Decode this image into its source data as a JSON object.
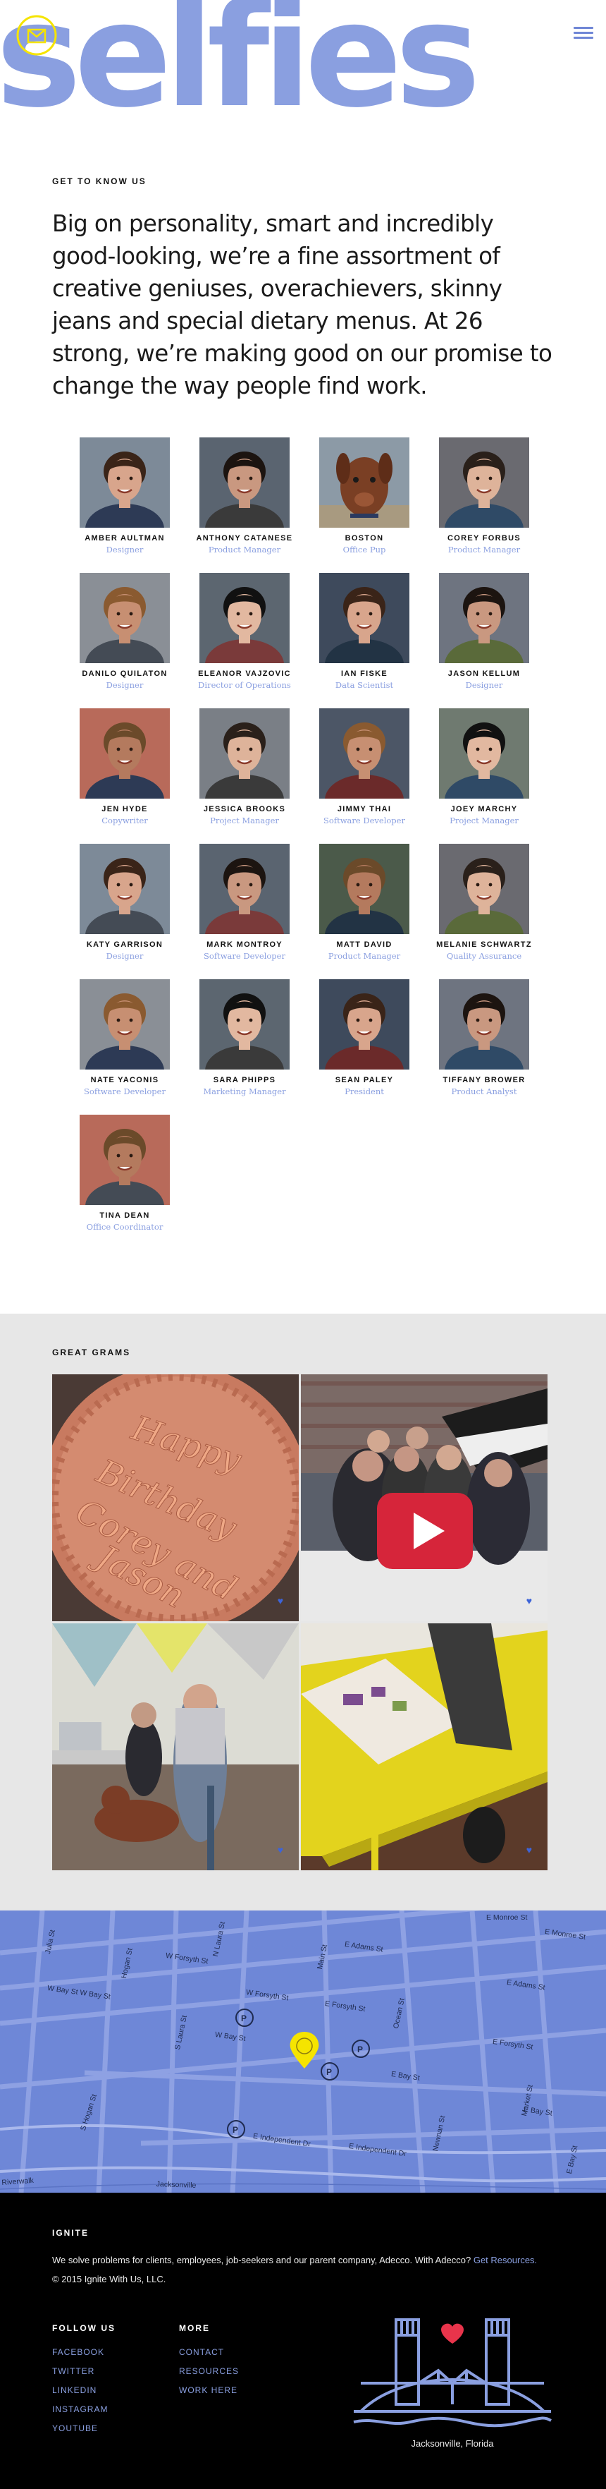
{
  "hero": {
    "word": "selfies",
    "logo_icon": "mail-location-badge-icon",
    "menu_icon": "hamburger-menu-icon",
    "accent_color": "#8a9fe0",
    "badge_color": "#f5e400"
  },
  "about": {
    "eyebrow": "GET TO KNOW US",
    "lead": "Big on personality, smart and incredibly good-looking, we’re a fine assortment of creative geniuses, overachievers, skinny jeans and special dietary menus. At 26 strong, we’re making good on our promise to change the way people find work."
  },
  "team": [
    {
      "name": "AMBER AULTMAN",
      "role": "Designer"
    },
    {
      "name": "ANTHONY CATANESE",
      "role": "Product Manager"
    },
    {
      "name": "BOSTON",
      "role": "Office Pup"
    },
    {
      "name": "COREY FORBUS",
      "role": "Product Manager"
    },
    {
      "name": "DANILO QUILATON",
      "role": "Designer"
    },
    {
      "name": "ELEANOR VAJZOVIC",
      "role": "Director of Operations"
    },
    {
      "name": "IAN FISKE",
      "role": "Data Scientist"
    },
    {
      "name": "JASON KELLUM",
      "role": "Designer"
    },
    {
      "name": "JEN HYDE",
      "role": "Copywriter"
    },
    {
      "name": "JESSICA BROOKS",
      "role": "Project Manager"
    },
    {
      "name": "JIMMY THAI",
      "role": "Software Developer"
    },
    {
      "name": "JOEY MARCHY",
      "role": "Project Manager"
    },
    {
      "name": "KATY GARRISON",
      "role": "Designer"
    },
    {
      "name": "MARK MONTROY",
      "role": "Software Developer"
    },
    {
      "name": "MATT DAVID",
      "role": "Product Manager"
    },
    {
      "name": "MELANIE SCHWARTZ",
      "role": "Quality Assurance"
    },
    {
      "name": "NATE YACONIS",
      "role": "Software Developer"
    },
    {
      "name": "SARA PHIPPS",
      "role": "Marketing Manager"
    },
    {
      "name": "SEAN PALEY",
      "role": "President"
    },
    {
      "name": "TIFFANY BROWER",
      "role": "Product Analyst"
    },
    {
      "name": "TINA DEAN",
      "role": "Office Coordinator"
    }
  ],
  "grams": {
    "title": "GREAT GRAMS",
    "like_icon": "heart-icon",
    "cake_text": [
      "Happy",
      "Birthday",
      "Corey and",
      "Jason"
    ]
  },
  "map": {
    "pin_icon": "map-pin-icon",
    "parking_icon": "parking-icon",
    "streets": [
      "E Monroe St",
      "Julia St",
      "W Forsyth St",
      "Hogan St",
      "N Laura St",
      "E Adams St",
      "W Bay St W Bay St",
      "W Forsyth St",
      "E Forsyth St",
      "S Laura St",
      "W Bay St",
      "E Bay St",
      "E Forsyth St",
      "S Hogan St",
      "E Independent Dr",
      "E Independent Dr",
      "E Bay St",
      "Newnan St",
      "Market St",
      "Ocean St",
      "Main St",
      "E Adams St",
      "E Monroe St",
      "E Bay St",
      "Riverwalk",
      "Jacksonville"
    ]
  },
  "footer": {
    "title": "IGNITE",
    "blurb": "We solve problems for clients, employees, job-seekers and our parent company, Adecco. With Adecco?",
    "blurb_link": "Get Resources.",
    "copyright": "© 2015 Ignite With Us, LLC.",
    "follow_title": "FOLLOW US",
    "follow_links": [
      "FACEBOOK",
      "TWITTER",
      "LINKEDIN",
      "INSTAGRAM",
      "YOUTUBE"
    ],
    "more_title": "MORE",
    "more_links": [
      "CONTACT",
      "RESOURCES",
      "WORK HERE"
    ],
    "bridge_icon": "jacksonville-bridge-icon",
    "heart_color": "#e8344b",
    "location": "Jacksonville, Florida"
  }
}
